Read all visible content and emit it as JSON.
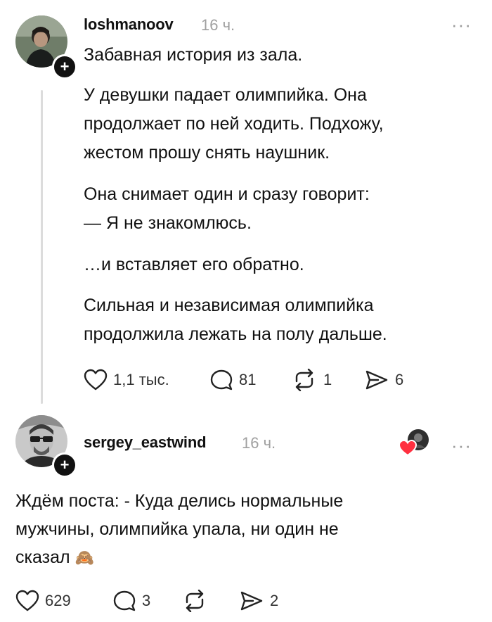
{
  "post": {
    "username": "loshmanoov",
    "time": "16 ч.",
    "more_label": "···",
    "plus_label": "+",
    "paragraphs": [
      "Забавная история из зала.",
      "У девушки падает олимпийка. Она\nпродолжает по ней ходить. Подхожу,\nжестом прошу снять наушник.",
      "Она снимает один и сразу говорит:\n— Я не знакомлюсь.",
      "…и вставляет его обратно.",
      "Сильная и независимая олимпийка\nпродолжила лежать на полу дальше."
    ],
    "actions": {
      "likes": "1,1 тыс.",
      "comments": "81",
      "reposts": "1",
      "shares": "6"
    }
  },
  "reply": {
    "username": "sergey_eastwind",
    "time": "16 ч.",
    "more_label": "···",
    "plus_label": "+",
    "text": "Ждём поста: - Куда делись нормальные\nмужчины, олимпийка упала, ни один не\nсказал",
    "emoji": "🙈",
    "actions": {
      "likes": "629",
      "comments": "3",
      "shares": "2"
    }
  },
  "colors": {
    "text": "#111111",
    "muted": "#a0a0a0",
    "heart_badge": "#ff3040",
    "thread_line": "#dcdcdc"
  },
  "icons": [
    "heart-icon",
    "comment-icon",
    "repost-icon",
    "share-icon",
    "more-icon",
    "plus-icon"
  ]
}
